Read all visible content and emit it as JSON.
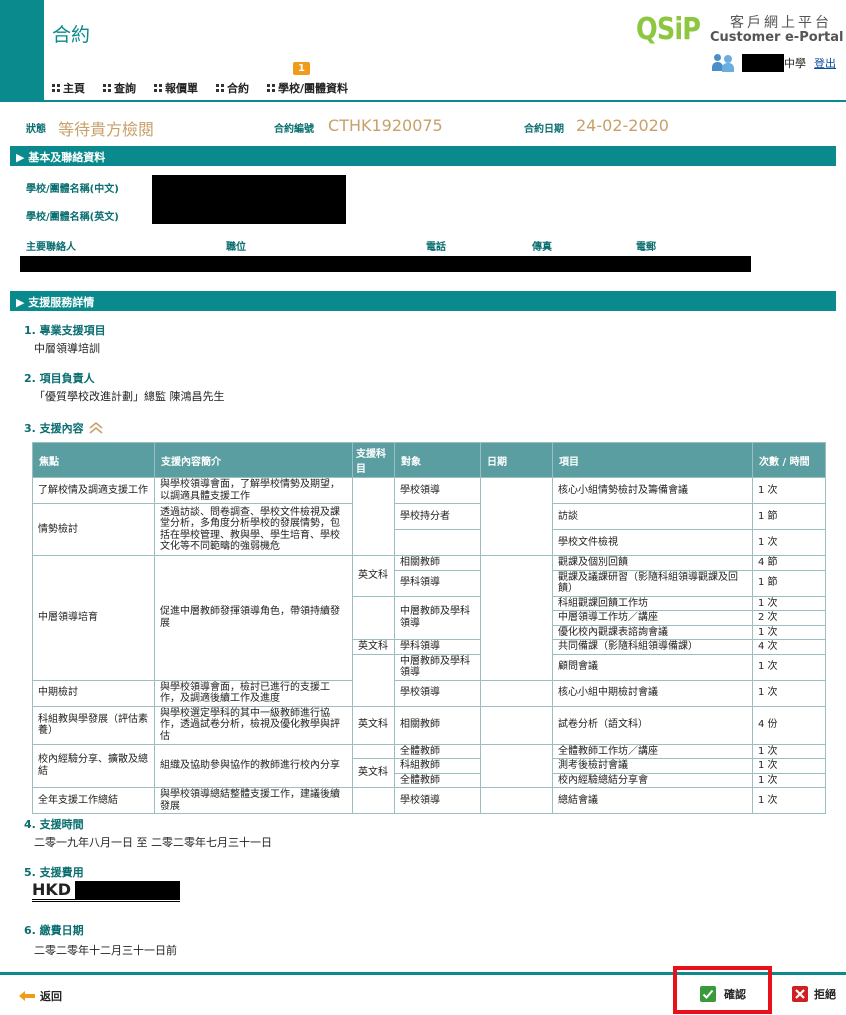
{
  "header": {
    "title": "合約",
    "logo": "QSiP",
    "portal_cn": "客戶網上平台",
    "portal_en": "Customer e-Portal",
    "user_school": "中學",
    "logout": "登出",
    "nav": [
      {
        "label": "主頁"
      },
      {
        "label": "查詢"
      },
      {
        "label": "報價單"
      },
      {
        "label": "合約"
      },
      {
        "label": "學校/團體資料"
      }
    ],
    "badge": "1"
  },
  "status": {
    "status_label": "狀態",
    "status_value": "等待貴方檢閱",
    "contract_no_label": "合約編號",
    "contract_no": "CTHK1920075",
    "contract_date_label": "合約日期",
    "contract_date": "24-02-2020"
  },
  "basic": {
    "section_title": "▶ 基本及聯絡資料",
    "school_cn_label": "學校/團體名稱(中文)",
    "school_en_label": "學校/團體名稱(英文)",
    "contact_label": "主要聯絡人",
    "position_label": "職位",
    "phone_label": "電話",
    "fax_label": "傳真",
    "email_label": "電郵"
  },
  "support": {
    "section_title": "▶ 支援服務詳情",
    "item1_title": "1. 專業支援項目",
    "item1_value": "中層領導培訓",
    "item2_title": "2. 項目負責人",
    "item2_value": "「優質學校改進計劃」總監  陳鴻昌先生",
    "item3_title": "3. 支援內容",
    "item4_title": "4. 支援時間",
    "item4_value": "二零一九年八月一日 至 二零二零年七月三十一日",
    "item5_title": "5. 支援費用",
    "item5_value": "HKD",
    "item6_title": "6. 繳費日期",
    "item6_value": "二零二零年十二月三十一日前"
  },
  "table": {
    "headers": [
      "焦點",
      "支援內容簡介",
      "支援科目",
      "對象",
      "日期",
      "項目",
      "次數 / 時間"
    ],
    "focus": [
      "了解校情及調適支援工作",
      "情勢檢討",
      "中層領導培育",
      "中期檢討",
      "科組教與學發展（評估素養）",
      "校內經驗分享、擴散及總結",
      "全年支援工作總結"
    ],
    "intro": [
      "與學校領導會面，了解學校情勢及期望，以調適具體支援工作",
      "透過訪談、問卷調查、學校文件檢視及課堂分析，多角度分析學校的發展情勢，包括在學校管理、教與學、學生培育、學校文化等不同範疇的強弱機危",
      "促進中層教師發揮領導角色，帶領持續發展",
      "與學校領導會面，檢討已進行的支援工作，及調適後續工作及進度",
      "與學校選定學科的其中一級教師進行協作，透過試卷分析，檢視及優化教學與評估",
      "組織及協助參與協作的教師進行校內分享",
      "與學校領導總結整體支援工作，建議後續發展"
    ],
    "subjects": [
      "英文科",
      "英文科",
      "英文科",
      "英文科"
    ],
    "targets": [
      "學校領導",
      "學校持分者",
      "相關教師",
      "學科領導",
      "中層教師及學科領導",
      "學科領導",
      "中層教師及學科領導",
      "學校領導",
      "相關教師",
      "全體教師",
      "科組教師",
      "全體教師",
      "學校領導"
    ],
    "items": [
      "核心小組情勢檢討及籌備會議",
      "訪談",
      "學校文件檢視",
      "觀課及個別回饋",
      "觀課及議課研習（影隨科組領導觀課及回饋）",
      "科組觀課回饋工作坊",
      "中層領導工作坊／講座",
      "優化校內觀課表諮詢會議",
      "共同備課（影隨科組領導備課）",
      "顧問會議",
      "核心小組中期檢討會議",
      "試卷分析（語文科）",
      "全體教師工作坊／講座",
      "測考後檢討會議",
      "校內經驗總結分享會",
      "總結會議"
    ],
    "counts": [
      "1 次",
      "1 節",
      "1 次",
      "4 節",
      "1 節",
      "1 次",
      "2 次",
      "1 次",
      "4 次",
      "1 次",
      "1 次",
      "4 份",
      "1 次",
      "1 次",
      "1 次",
      "1 次"
    ]
  },
  "footer": {
    "back": "返回",
    "confirm": "確認",
    "reject": "拒絕"
  },
  "colors": {
    "teal": "#0a8a8c",
    "table_header": "#5a9ea1",
    "accent": "#f29a1a",
    "status": "#c8a06a"
  }
}
